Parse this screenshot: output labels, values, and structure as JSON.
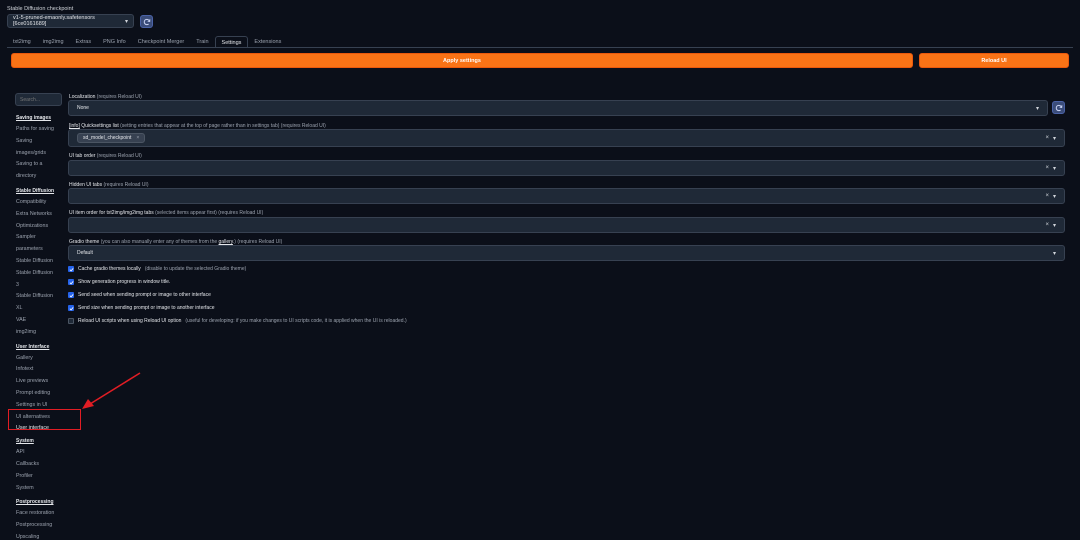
{
  "checkpoint": {
    "label": "Stable Diffusion checkpoint",
    "value": "v1-5-pruned-emaonly.safetensors [6ce0161689]"
  },
  "tabs": [
    "txt2img",
    "img2img",
    "Extras",
    "PNG Info",
    "Checkpoint Merger",
    "Train",
    "Settings",
    "Extensions"
  ],
  "active_tab": "Settings",
  "actions": {
    "apply": "Apply settings",
    "reload": "Reload UI"
  },
  "search": {
    "placeholder": "Search..."
  },
  "sidebar": [
    {
      "type": "head",
      "label": "Saving images"
    },
    {
      "type": "item",
      "label": "Paths for saving"
    },
    {
      "type": "item",
      "label": "Saving"
    },
    {
      "type": "item",
      "label": "images/grids"
    },
    {
      "type": "item",
      "label": "Saving to a"
    },
    {
      "type": "item",
      "label": "directory"
    },
    {
      "type": "gap"
    },
    {
      "type": "head",
      "label": "Stable Diffusion"
    },
    {
      "type": "item",
      "label": "Compatibility"
    },
    {
      "type": "item",
      "label": "Extra Networks"
    },
    {
      "type": "item",
      "label": "Optimizations"
    },
    {
      "type": "item",
      "label": "Sampler"
    },
    {
      "type": "item",
      "label": "parameters"
    },
    {
      "type": "item",
      "label": "Stable Diffusion"
    },
    {
      "type": "item",
      "label": "Stable Diffusion"
    },
    {
      "type": "item",
      "label": "3"
    },
    {
      "type": "item",
      "label": "Stable Diffusion"
    },
    {
      "type": "item",
      "label": "XL"
    },
    {
      "type": "item",
      "label": "VAE"
    },
    {
      "type": "item",
      "label": "img2img"
    },
    {
      "type": "gap"
    },
    {
      "type": "head",
      "label": "User Interface"
    },
    {
      "type": "item",
      "label": "Gallery"
    },
    {
      "type": "item",
      "label": "Infotext"
    },
    {
      "type": "item",
      "label": "Live previews"
    },
    {
      "type": "item",
      "label": "Prompt editing"
    },
    {
      "type": "item",
      "label": "Settings in UI"
    },
    {
      "type": "item",
      "label": "UI alternatives"
    },
    {
      "type": "item",
      "label": "User interface",
      "selected": true
    },
    {
      "type": "head",
      "label": "System"
    },
    {
      "type": "item",
      "label": "API"
    },
    {
      "type": "item",
      "label": "Callbacks"
    },
    {
      "type": "item",
      "label": "Profiler"
    },
    {
      "type": "item",
      "label": "System"
    },
    {
      "type": "gap"
    },
    {
      "type": "head",
      "label": "Postprocessing"
    },
    {
      "type": "item",
      "label": "Face restoration"
    },
    {
      "type": "item",
      "label": "Postprocessing"
    },
    {
      "type": "item",
      "label": "Upscaling"
    }
  ],
  "settings": {
    "localization": {
      "label": "Localization",
      "sub": "(requires Reload UI)",
      "value": "None"
    },
    "quicksettings": {
      "link": "[info]",
      "label": "Quicksettings list",
      "sub": "(setting entries that appear at the top of page rather than in settings tab) (requires Reload UI)",
      "chip": "sd_model_checkpoint"
    },
    "tab_order": {
      "label": "UI tab order",
      "sub": "(requires Reload UI)"
    },
    "hidden_tabs": {
      "label": "Hidden UI tabs",
      "sub": "(requires Reload UI)"
    },
    "item_order": {
      "label": "UI item order for txt2img/img2img tabs",
      "sub": "(selected items appear first) (requires Reload UI)"
    },
    "theme": {
      "label": "Gradio theme",
      "sub_a": "(you can also manually enter any of themes from the",
      "link": "gallery",
      "sub_b": ".) (requires Reload UI)",
      "value": "Default"
    }
  },
  "checkboxes": [
    {
      "label": "Cache gradio themes locally",
      "sub": "(disable to update the selected Gradio theme)",
      "checked": true
    },
    {
      "label": "Show generation progress in window title.",
      "sub": "",
      "checked": true
    },
    {
      "label": "Send seed when sending prompt or image to other interface",
      "sub": "",
      "checked": true
    },
    {
      "label": "Send size when sending prompt or image to another interface",
      "sub": "",
      "checked": true
    },
    {
      "label": "Reload UI scripts when using Reload UI option",
      "sub": "(useful for developing: if you make changes to UI scripts code, it is applied when the UI is reloaded.)",
      "checked": false
    }
  ],
  "glyphs": {
    "chevron": "▾",
    "clear": "×"
  },
  "colors": {
    "accent": "#f97316",
    "highlight": "#e11d24",
    "checkbox": "#2563eb"
  }
}
